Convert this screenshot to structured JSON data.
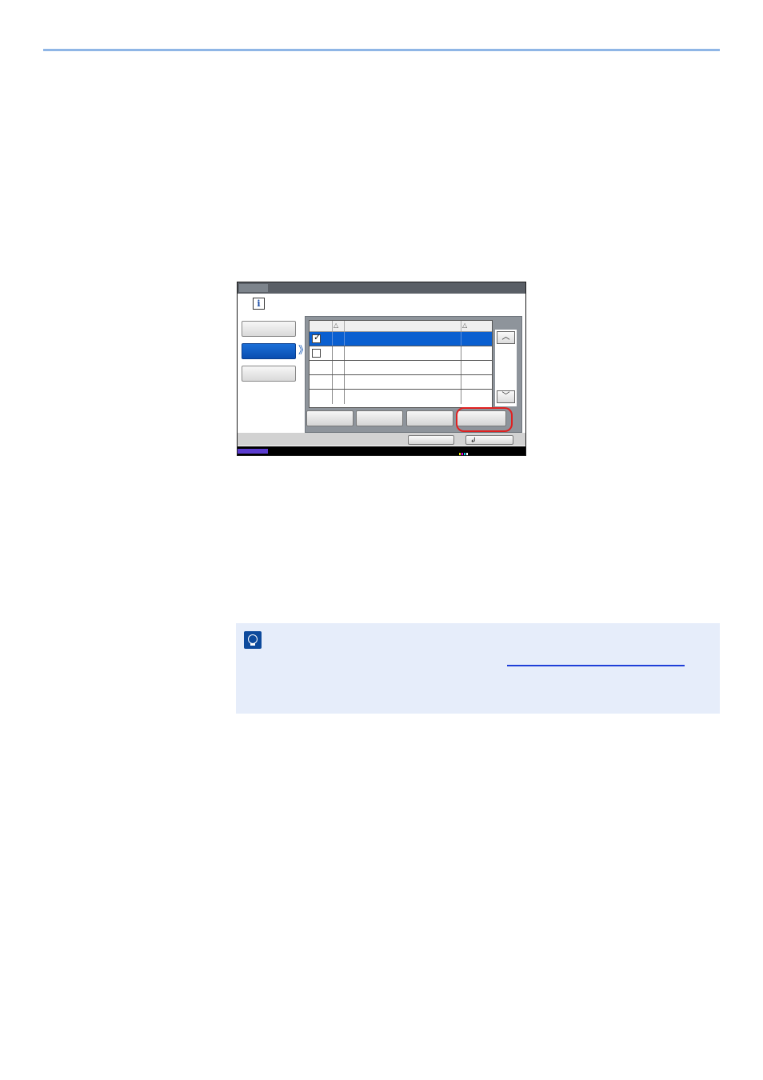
{
  "panel": {
    "info_icon_glyph": "i",
    "list_rows": [
      {
        "checked": true,
        "selected": true
      },
      {
        "checked": false,
        "selected": false
      },
      {
        "checked": null,
        "selected": false
      },
      {
        "checked": null,
        "selected": false
      },
      {
        "checked": null,
        "selected": false
      }
    ],
    "scroll_up_glyph": "︿",
    "scroll_down_glyph": "﹀",
    "side_arrow_glyph": "》",
    "checkmark_glyph": "✓",
    "enter_glyph": "↲",
    "colors": {
      "selected_row": "#0a5fd0",
      "highlight_ring": "#e02020",
      "accent_bar": "#5b3ccf",
      "rule": "#8fb6e6",
      "note_bg": "#e6edfa",
      "link": "#1f3fd8"
    }
  }
}
